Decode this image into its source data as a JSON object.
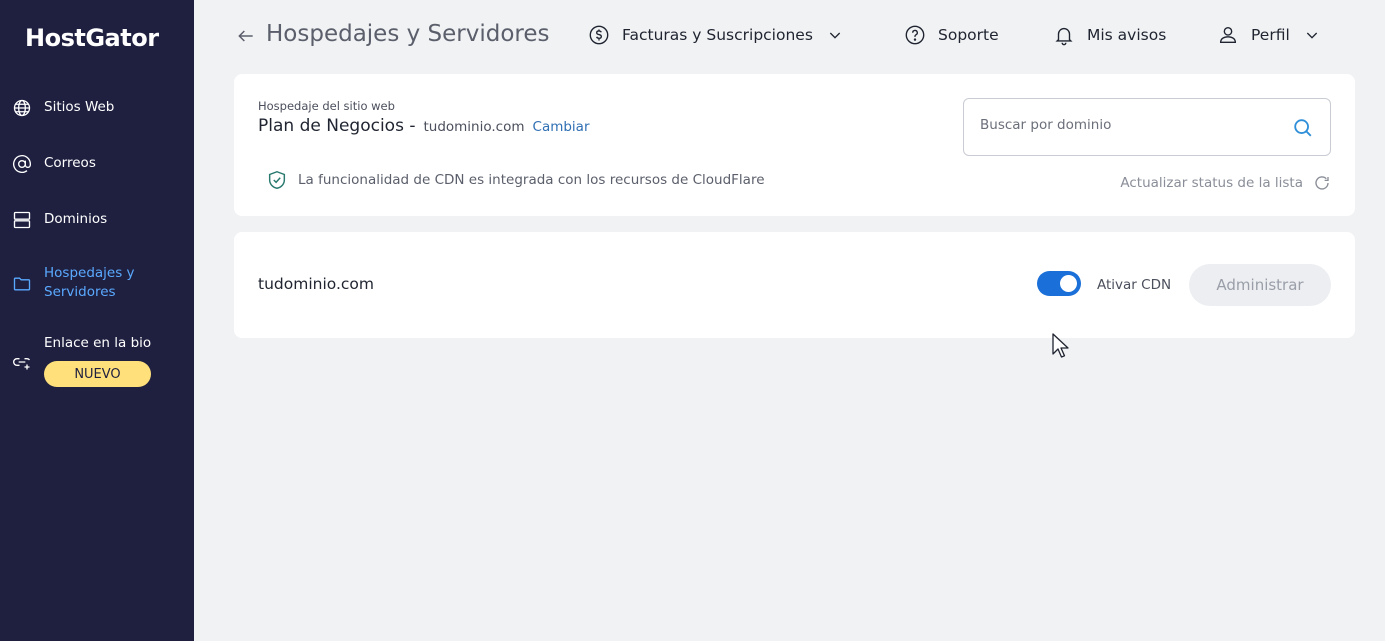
{
  "brand": {
    "logo_text": "HostGator"
  },
  "sidebar": {
    "items": [
      {
        "label": "Sitios Web",
        "icon": "globe-icon"
      },
      {
        "label": "Correos",
        "icon": "at-sign-icon"
      },
      {
        "label": "Dominios",
        "icon": "server-icon"
      },
      {
        "label": "Hospedajes y Servidores",
        "icon": "folder-icon",
        "active": true
      },
      {
        "label": "Enlace en la bio",
        "icon": "link-add-icon",
        "badge": "NUEVO"
      }
    ]
  },
  "header": {
    "title": "Hospedajes y Servidores",
    "billing_label": "Facturas y Suscripciones",
    "support_label": "Soporte",
    "notifications_label": "Mis avisos",
    "profile_label": "Perfil"
  },
  "hosting": {
    "sub_label": "Hospedaje del sitio web",
    "plan_name": "Plan de Negocios -",
    "domain": "tudominio.com",
    "change_label": "Cambiar",
    "cdn_note": "La funcionalidad de CDN es integrada con los recursos de CloudFlare",
    "search_placeholder": "Buscar por dominio",
    "refresh_label": "Actualizar status de la lista"
  },
  "domain_row": {
    "domain": "tudominio.com",
    "cdn_label": "Ativar CDN",
    "cdn_enabled": true,
    "manage_label": "Administrar"
  },
  "colors": {
    "sidebar_bg": "#1f2040",
    "active_nav": "#5aa9ff",
    "toggle_on": "#1a6fd8",
    "badge_bg": "#ffe07a",
    "link": "#2f6fb4"
  }
}
